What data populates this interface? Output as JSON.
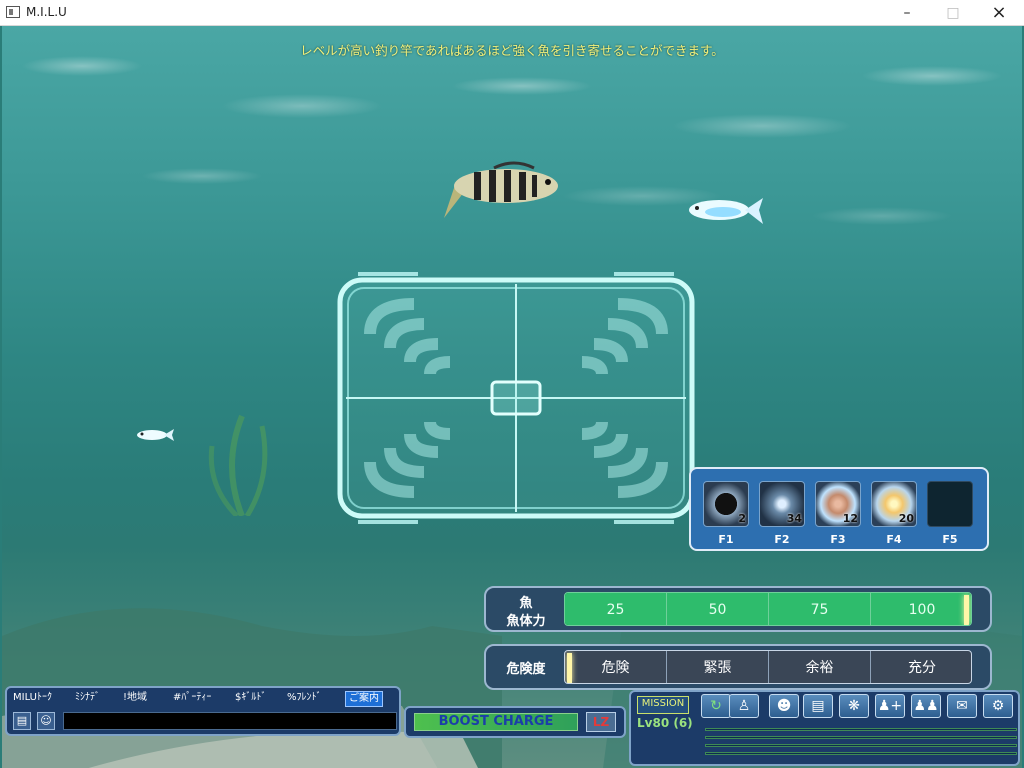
{
  "window": {
    "title": "M.I.L.U"
  },
  "hint_text": "レベルが高い釣り竿であればあるほど強く魚を引き寄せることができます。",
  "skills": [
    {
      "key": "F1",
      "count": "2",
      "icon": "dark-orb-icon"
    },
    {
      "key": "F2",
      "count": "34",
      "icon": "star-orb-icon"
    },
    {
      "key": "F3",
      "count": "12",
      "icon": "glow-orb-icon"
    },
    {
      "key": "F4",
      "count": "20",
      "icon": "sparkle-orb-icon"
    },
    {
      "key": "F5",
      "count": "",
      "icon": "empty-slot"
    }
  ],
  "fish_stamina": {
    "label_top": "魚",
    "label": "魚体力",
    "ticks": [
      "25",
      "50",
      "75",
      "100"
    ],
    "level_percent": 100,
    "color": "#2ebc6c"
  },
  "danger": {
    "label": "危険度",
    "ticks": [
      "危険",
      "緊張",
      "余裕",
      "充分"
    ],
    "level_percent": 0,
    "color": "#3a4656"
  },
  "chat": {
    "tabs": [
      "MILUﾄｰｸ",
      "ﾐｼﾅﾃﾞ",
      "!地域",
      "#ﾊﾟｰﾃｨｰ",
      "$ｷﾞﾙﾄﾞ",
      "%ﾌﾚﾝﾄﾞ",
      "ご案内"
    ],
    "input_value": ""
  },
  "boost": {
    "label": "BOOST CHARGE",
    "key_label": "LZ"
  },
  "hud": {
    "mission_label": "MISSION",
    "level_text": "Lv80 (6)",
    "icons": [
      "refresh-icon",
      "character-icon",
      "profile-icon",
      "vehicle-icon",
      "skill-icon",
      "party-add-icon",
      "party-icon",
      "chat-bubble-icon",
      "settings-gears-icon"
    ]
  }
}
